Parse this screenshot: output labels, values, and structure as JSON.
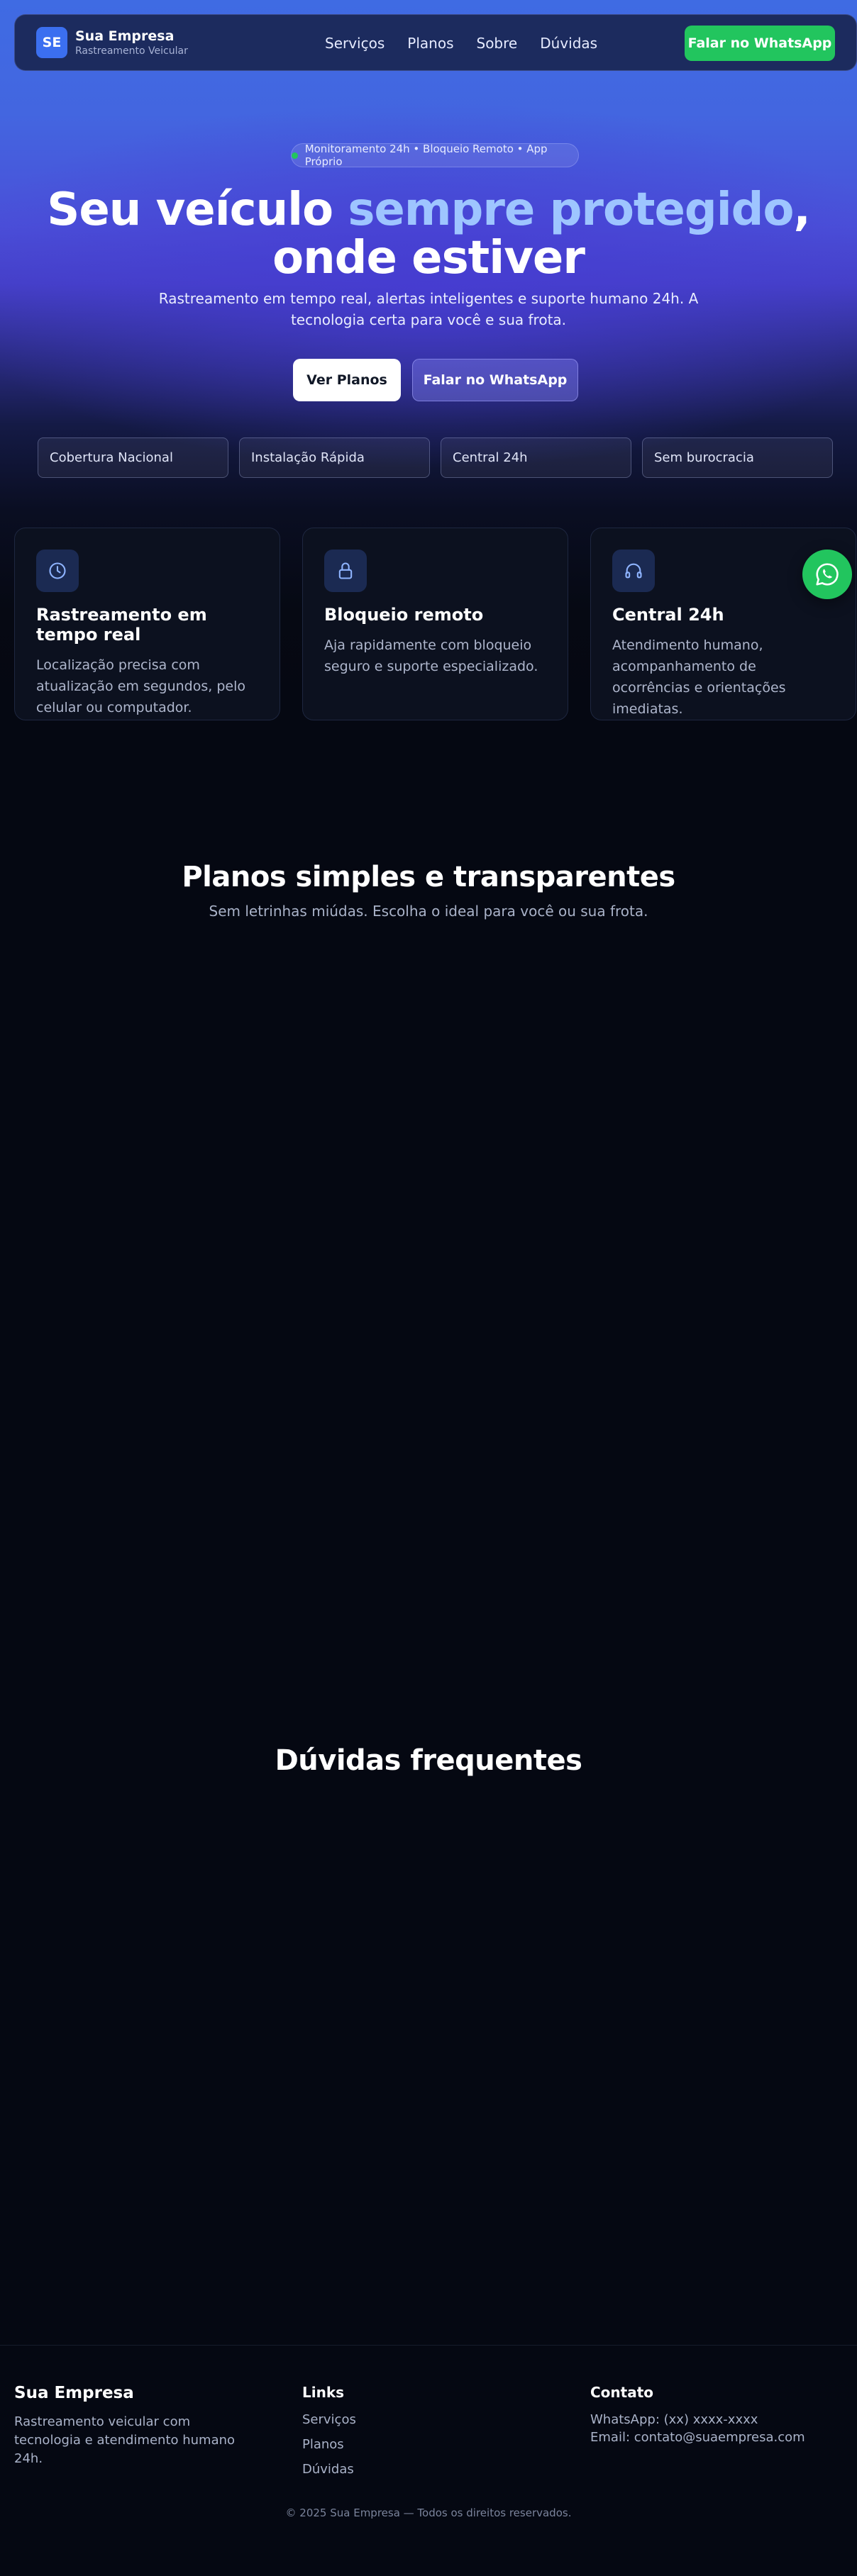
{
  "nav": {
    "logo_initials": "SE",
    "brand_name": "Sua Empresa",
    "brand_tagline": "Rastreamento Veicular",
    "links": [
      "Serviços",
      "Planos",
      "Sobre",
      "Dúvidas"
    ],
    "cta_label": "Falar no WhatsApp"
  },
  "hero": {
    "badge": "Monitoramento 24h • Bloqueio Remoto • App Próprio",
    "title_part1": "Seu veículo ",
    "title_highlight": "sempre protegido",
    "title_part2": ",",
    "title_line2": "onde estiver",
    "subtitle": "Rastreamento em tempo real, alertas inteligentes e suporte humano 24h. A tecnologia certa para você e sua frota.",
    "primary_button": "Ver Planos",
    "secondary_button": "Falar no WhatsApp",
    "features": [
      "Cobertura Nacional",
      "Instalação Rápida",
      "Central 24h",
      "Sem burocracia"
    ]
  },
  "services": [
    {
      "icon": "clock-icon",
      "title": "Rastreamento em tempo real",
      "text": "Localização precisa com atualização em segundos, pelo celular ou computador."
    },
    {
      "icon": "lock-icon",
      "title": "Bloqueio remoto",
      "text": "Aja rapidamente com bloqueio seguro e suporte especializado."
    },
    {
      "icon": "headphones-icon",
      "title": "Central 24h",
      "text": "Atendimento humano, acompanhamento de ocorrências e orientações imediatas."
    }
  ],
  "plans": {
    "title": "Planos simples e transparentes",
    "subtitle": "Sem letrinhas miúdas. Escolha o ideal para você ou sua frota."
  },
  "faq": {
    "title": "Dúvidas frequentes"
  },
  "footer": {
    "brand": "Sua Empresa",
    "description": "Rastreamento veicular com tecnologia e atendimento humano 24h.",
    "links_title": "Links",
    "links": [
      "Serviços",
      "Planos",
      "Dúvidas"
    ],
    "contact_title": "Contato",
    "whatsapp": "WhatsApp: (xx) xxxx-xxxx",
    "email": "Email: contato@suaempresa.com",
    "copyright": "© 2025 Sua Empresa — Todos os direitos reservados."
  },
  "colors": {
    "accent_green": "#22c55e",
    "brand_blue": "#3b6ff0",
    "highlight_blue": "#9ec5ff",
    "background": "#050812"
  }
}
